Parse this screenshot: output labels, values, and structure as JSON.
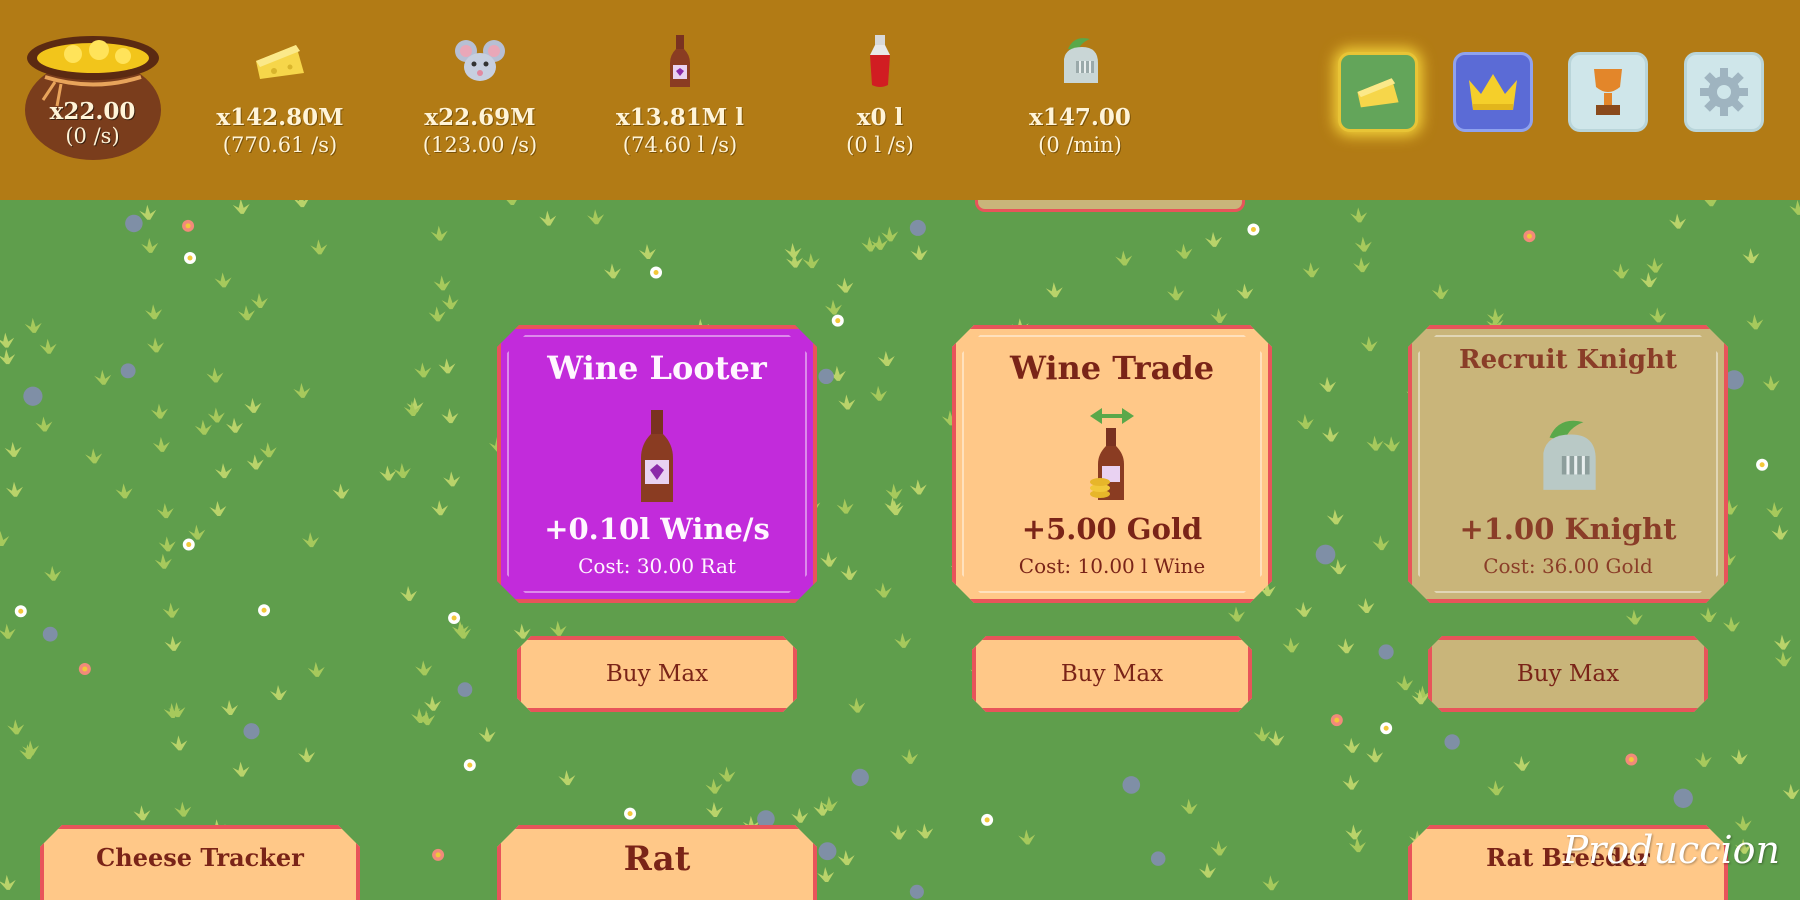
{
  "resources": {
    "gold": {
      "icon": "gold-bag-icon",
      "amount": "x22.00",
      "rate": "(0 /s)"
    },
    "cheese": {
      "icon": "cheese-icon",
      "amount": "x142.80M",
      "rate": "(770.61 /s)"
    },
    "rat": {
      "icon": "rat-icon",
      "amount": "x22.69M",
      "rate": "(123.00 /s)"
    },
    "wine": {
      "icon": "wine-bottle-icon",
      "amount": "x13.81M l",
      "rate": "(74.60 l /s)"
    },
    "blood": {
      "icon": "red-potion-icon",
      "amount": "x0 l",
      "rate": "(0 l /s)"
    },
    "knight": {
      "icon": "knight-helmet-icon",
      "amount": "x147.00",
      "rate": "(0 /min)"
    }
  },
  "nav": [
    {
      "name": "cheese",
      "icon": "cheese-icon"
    },
    {
      "name": "crown",
      "icon": "crown-icon"
    },
    {
      "name": "trophy",
      "icon": "trophy-icon"
    },
    {
      "name": "settings",
      "icon": "gear-icon"
    }
  ],
  "cards": {
    "wine_looter": {
      "title": "Wine Looter",
      "effect": "+0.10l Wine/s",
      "cost": "Cost: 30.00 Rat",
      "state": "active"
    },
    "wine_trade": {
      "title": "Wine Trade",
      "effect": "+5.00 Gold",
      "cost": "Cost: 10.00 l Wine",
      "state": "normal"
    },
    "recruit_knight": {
      "title": "Recruit Knight",
      "effect": "+1.00 Knight",
      "cost": "Cost: 36.00 Gold",
      "state": "locked"
    }
  },
  "buy_max_label": "Buy Max",
  "bottom_cards": {
    "cheese_tracker": "Cheese Tracker",
    "rat": "Rat",
    "right": "Rat Breeder"
  },
  "section_label": "Produccion",
  "colors": {
    "topbar": "#b27b15",
    "grass": "#5f9e4c",
    "card": "#ffc888",
    "card_active": "#c22bdb",
    "card_locked": "#c9b57a",
    "card_border": "#e8545a"
  }
}
